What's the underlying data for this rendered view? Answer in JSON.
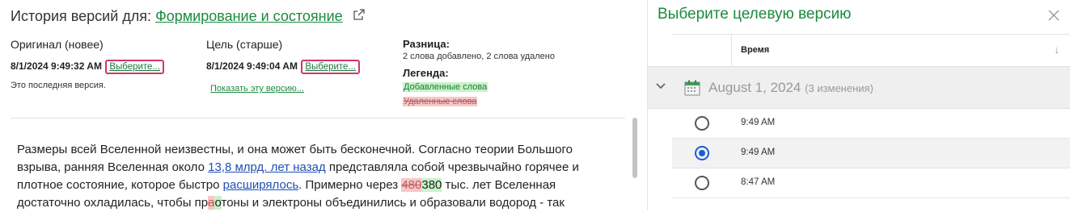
{
  "history": {
    "title_prefix": "История версий для:",
    "doc_link": "Формирование и состояние"
  },
  "original": {
    "heading": "Оригинал (новее)",
    "datetime": "8/1/2024 9:49:32 AM",
    "select_link": "Выберите...",
    "note": "Это последняя версия."
  },
  "target": {
    "heading": "Цель (старше)",
    "datetime": "8/1/2024 9:49:04 AM",
    "select_link": "Выберите...",
    "show_link": "Показать эту версию..."
  },
  "diff": {
    "heading": "Разница:",
    "summary": "2 слова добавлено, 2 слова удалено",
    "legend_heading": "Легенда:",
    "added_label": "Добавленные слова",
    "removed_label": "Удаленные слова"
  },
  "content": {
    "p1": "Размеры всей Вселенной неизвестны, и она может быть бесконечной. Согласно теории Большого взрыва, ранняя Вселенная около ",
    "link1": "13,8 млрд. лет назад",
    "p2": " представляла собой чрезвычайно горячее и плотное состояние, которое быстро ",
    "link2": "расширялось",
    "p3": ". Примерно через ",
    "del1": "480",
    "ins1": "380",
    "p4": " тыс. лет Вселенная достаточно охладилась, чтобы пр",
    "del2": "а",
    "ins2": "о",
    "p5": "тоны и электроны объединились и образовали водород - так"
  },
  "panel": {
    "title": "Выберите целевую версию",
    "col_time": "Время",
    "sort_icon": "↓",
    "group_date": "August 1, 2024",
    "group_count": "(3 изменения)",
    "rows": [
      {
        "time": "9:49 AM",
        "selected": false
      },
      {
        "time": "9:49 AM",
        "selected": true
      },
      {
        "time": "8:47 AM",
        "selected": false
      }
    ]
  },
  "colors": {
    "accent_green": "#1a8a3e",
    "highlight_pink": "#d6336c",
    "radio_blue": "#1a5cd8",
    "added_bg": "#c9f2c9",
    "removed_bg": "#f7c6c6"
  }
}
